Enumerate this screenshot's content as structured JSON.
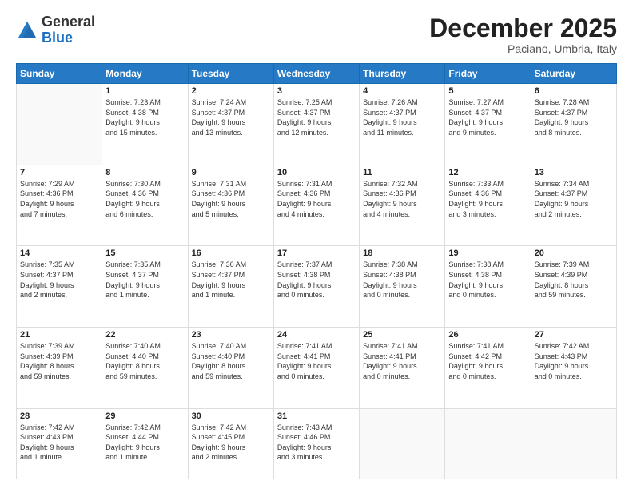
{
  "header": {
    "logo_general": "General",
    "logo_blue": "Blue",
    "month_title": "December 2025",
    "location": "Paciano, Umbria, Italy"
  },
  "weekdays": [
    "Sunday",
    "Monday",
    "Tuesday",
    "Wednesday",
    "Thursday",
    "Friday",
    "Saturday"
  ],
  "weeks": [
    [
      {
        "day": "",
        "content": ""
      },
      {
        "day": "1",
        "content": "Sunrise: 7:23 AM\nSunset: 4:38 PM\nDaylight: 9 hours\nand 15 minutes."
      },
      {
        "day": "2",
        "content": "Sunrise: 7:24 AM\nSunset: 4:37 PM\nDaylight: 9 hours\nand 13 minutes."
      },
      {
        "day": "3",
        "content": "Sunrise: 7:25 AM\nSunset: 4:37 PM\nDaylight: 9 hours\nand 12 minutes."
      },
      {
        "day": "4",
        "content": "Sunrise: 7:26 AM\nSunset: 4:37 PM\nDaylight: 9 hours\nand 11 minutes."
      },
      {
        "day": "5",
        "content": "Sunrise: 7:27 AM\nSunset: 4:37 PM\nDaylight: 9 hours\nand 9 minutes."
      },
      {
        "day": "6",
        "content": "Sunrise: 7:28 AM\nSunset: 4:37 PM\nDaylight: 9 hours\nand 8 minutes."
      }
    ],
    [
      {
        "day": "7",
        "content": "Sunrise: 7:29 AM\nSunset: 4:36 PM\nDaylight: 9 hours\nand 7 minutes."
      },
      {
        "day": "8",
        "content": "Sunrise: 7:30 AM\nSunset: 4:36 PM\nDaylight: 9 hours\nand 6 minutes."
      },
      {
        "day": "9",
        "content": "Sunrise: 7:31 AM\nSunset: 4:36 PM\nDaylight: 9 hours\nand 5 minutes."
      },
      {
        "day": "10",
        "content": "Sunrise: 7:31 AM\nSunset: 4:36 PM\nDaylight: 9 hours\nand 4 minutes."
      },
      {
        "day": "11",
        "content": "Sunrise: 7:32 AM\nSunset: 4:36 PM\nDaylight: 9 hours\nand 4 minutes."
      },
      {
        "day": "12",
        "content": "Sunrise: 7:33 AM\nSunset: 4:36 PM\nDaylight: 9 hours\nand 3 minutes."
      },
      {
        "day": "13",
        "content": "Sunrise: 7:34 AM\nSunset: 4:37 PM\nDaylight: 9 hours\nand 2 minutes."
      }
    ],
    [
      {
        "day": "14",
        "content": "Sunrise: 7:35 AM\nSunset: 4:37 PM\nDaylight: 9 hours\nand 2 minutes."
      },
      {
        "day": "15",
        "content": "Sunrise: 7:35 AM\nSunset: 4:37 PM\nDaylight: 9 hours\nand 1 minute."
      },
      {
        "day": "16",
        "content": "Sunrise: 7:36 AM\nSunset: 4:37 PM\nDaylight: 9 hours\nand 1 minute."
      },
      {
        "day": "17",
        "content": "Sunrise: 7:37 AM\nSunset: 4:38 PM\nDaylight: 9 hours\nand 0 minutes."
      },
      {
        "day": "18",
        "content": "Sunrise: 7:38 AM\nSunset: 4:38 PM\nDaylight: 9 hours\nand 0 minutes."
      },
      {
        "day": "19",
        "content": "Sunrise: 7:38 AM\nSunset: 4:38 PM\nDaylight: 9 hours\nand 0 minutes."
      },
      {
        "day": "20",
        "content": "Sunrise: 7:39 AM\nSunset: 4:39 PM\nDaylight: 8 hours\nand 59 minutes."
      }
    ],
    [
      {
        "day": "21",
        "content": "Sunrise: 7:39 AM\nSunset: 4:39 PM\nDaylight: 8 hours\nand 59 minutes."
      },
      {
        "day": "22",
        "content": "Sunrise: 7:40 AM\nSunset: 4:40 PM\nDaylight: 8 hours\nand 59 minutes."
      },
      {
        "day": "23",
        "content": "Sunrise: 7:40 AM\nSunset: 4:40 PM\nDaylight: 8 hours\nand 59 minutes."
      },
      {
        "day": "24",
        "content": "Sunrise: 7:41 AM\nSunset: 4:41 PM\nDaylight: 9 hours\nand 0 minutes."
      },
      {
        "day": "25",
        "content": "Sunrise: 7:41 AM\nSunset: 4:41 PM\nDaylight: 9 hours\nand 0 minutes."
      },
      {
        "day": "26",
        "content": "Sunrise: 7:41 AM\nSunset: 4:42 PM\nDaylight: 9 hours\nand 0 minutes."
      },
      {
        "day": "27",
        "content": "Sunrise: 7:42 AM\nSunset: 4:43 PM\nDaylight: 9 hours\nand 0 minutes."
      }
    ],
    [
      {
        "day": "28",
        "content": "Sunrise: 7:42 AM\nSunset: 4:43 PM\nDaylight: 9 hours\nand 1 minute."
      },
      {
        "day": "29",
        "content": "Sunrise: 7:42 AM\nSunset: 4:44 PM\nDaylight: 9 hours\nand 1 minute."
      },
      {
        "day": "30",
        "content": "Sunrise: 7:42 AM\nSunset: 4:45 PM\nDaylight: 9 hours\nand 2 minutes."
      },
      {
        "day": "31",
        "content": "Sunrise: 7:43 AM\nSunset: 4:46 PM\nDaylight: 9 hours\nand 3 minutes."
      },
      {
        "day": "",
        "content": ""
      },
      {
        "day": "",
        "content": ""
      },
      {
        "day": "",
        "content": ""
      }
    ]
  ]
}
